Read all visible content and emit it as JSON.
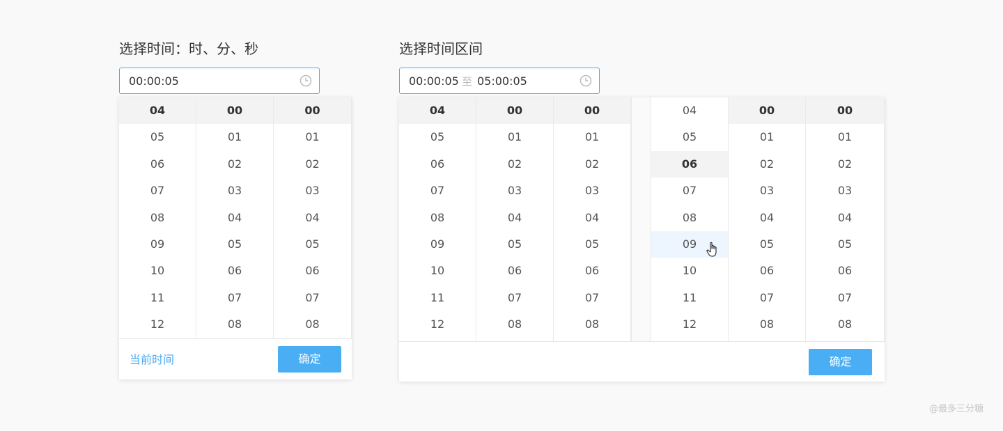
{
  "single": {
    "title": "选择时间：时、分、秒",
    "value": "00:00:05",
    "columns": [
      [
        "04",
        "05",
        "06",
        "07",
        "08",
        "09",
        "10",
        "11",
        "12"
      ],
      [
        "00",
        "01",
        "02",
        "03",
        "04",
        "05",
        "06",
        "07",
        "08"
      ],
      [
        "00",
        "01",
        "02",
        "03",
        "04",
        "05",
        "06",
        "07",
        "08"
      ]
    ],
    "now_label": "当前时间",
    "ok_label": "确定"
  },
  "range": {
    "title": "选择时间区间",
    "start": "00:00:05",
    "separator": "至",
    "end": "05:00:05",
    "start_columns": [
      [
        "04",
        "05",
        "06",
        "07",
        "08",
        "09",
        "10",
        "11",
        "12"
      ],
      [
        "00",
        "01",
        "02",
        "03",
        "04",
        "05",
        "06",
        "07",
        "08"
      ],
      [
        "00",
        "01",
        "02",
        "03",
        "04",
        "05",
        "06",
        "07",
        "08"
      ]
    ],
    "end_columns": [
      [
        "04",
        "05",
        "06",
        "07",
        "08",
        "09",
        "10",
        "11",
        "12"
      ],
      [
        "00",
        "01",
        "02",
        "03",
        "04",
        "05",
        "06",
        "07",
        "08"
      ],
      [
        "00",
        "01",
        "02",
        "03",
        "04",
        "05",
        "06",
        "07",
        "08"
      ]
    ],
    "ok_label": "确定"
  },
  "watermark": "@最多三分糖",
  "colors": {
    "accent": "#4aa8f0",
    "button": "#4aaef5",
    "selected_bg": "#f3f3f3",
    "hover_bg": "#edf5fe"
  },
  "icons": {
    "input": "clock-icon",
    "cursor": "hand-pointer-icon"
  }
}
